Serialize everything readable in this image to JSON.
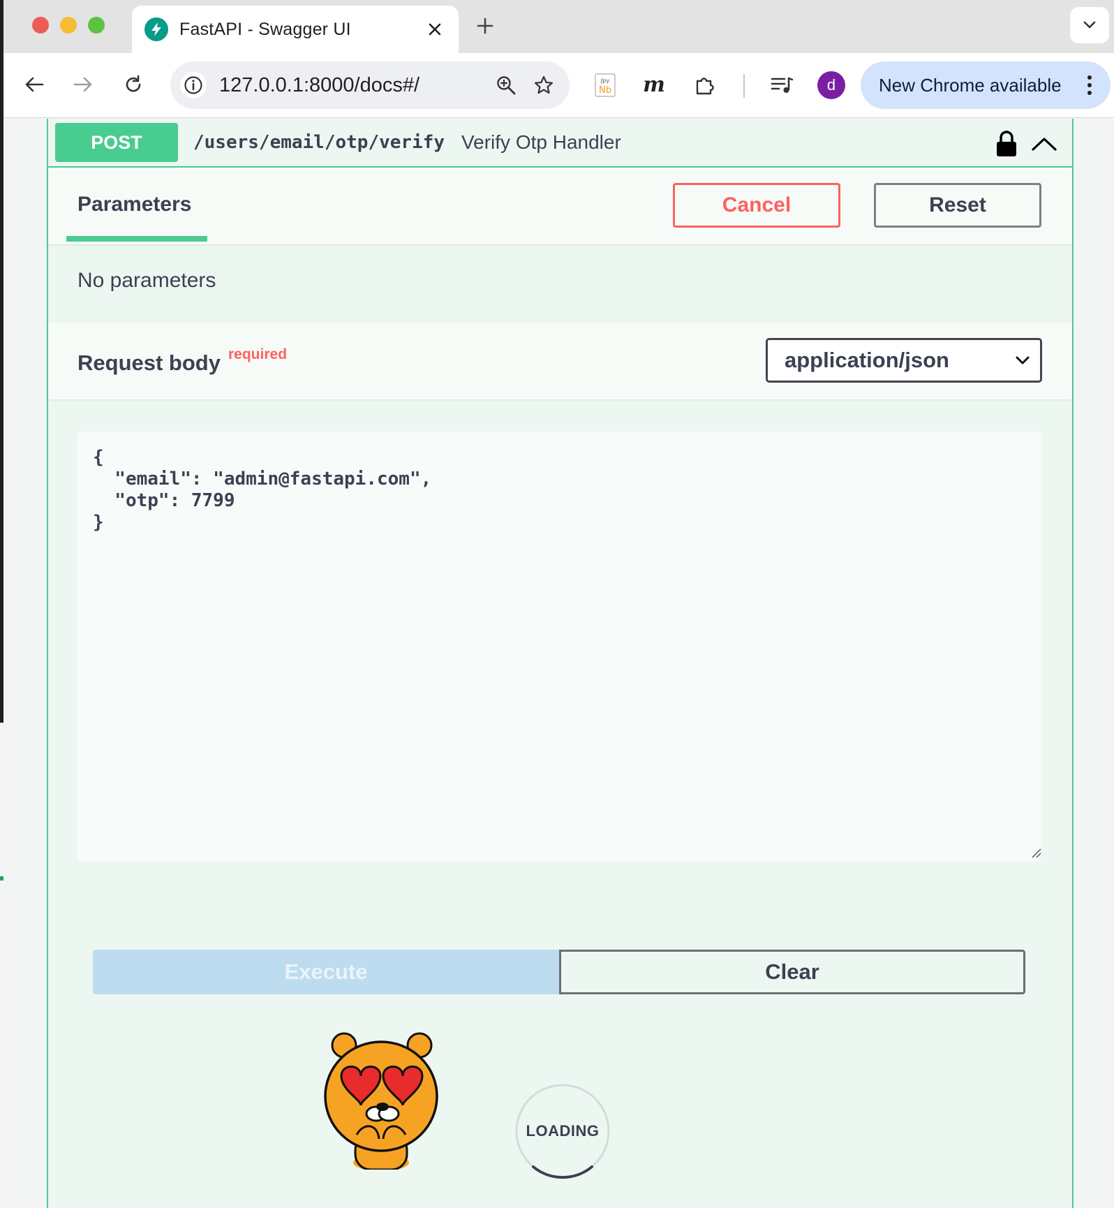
{
  "browser": {
    "tab": {
      "title": "FastAPI - Swagger UI",
      "favicon": "fastapi-icon"
    },
    "url": "127.0.0.1:8000/docs#/",
    "update_label": "New Chrome available",
    "avatar_letter": "d",
    "extensions": [
      "jupyter-nb-icon",
      "m-extension-icon",
      "puzzle-icon",
      "media-control-icon"
    ]
  },
  "operation": {
    "method": "POST",
    "path": "/users/email/otp/verify",
    "summary": "Verify Otp Handler",
    "tab_parameters": "Parameters",
    "cancel_label": "Cancel",
    "reset_label": "Reset",
    "no_parameters": "No parameters",
    "request_body_label": "Request body",
    "required_label": "required",
    "content_type": "application/json",
    "body_text": "{\n  \"email\": \"admin@fastapi.com\",\n  \"otp\": 7799\n}",
    "execute_label": "Execute",
    "clear_label": "Clear",
    "loading_label": "LOADING"
  },
  "colors": {
    "post_green": "#49cc90",
    "cancel_red": "#ff6060",
    "execute_disabled": "#bedcef",
    "chrome_update_blue": "#d3e3fd",
    "avatar_purple": "#7b1fa2"
  }
}
